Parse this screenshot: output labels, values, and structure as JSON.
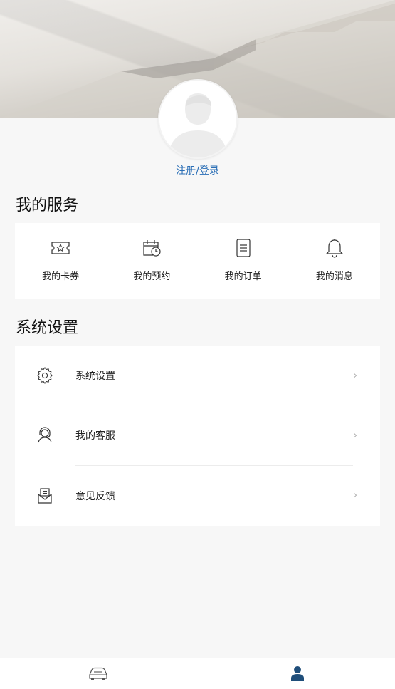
{
  "profile": {
    "login_label": "注册/登录"
  },
  "services": {
    "title": "我的服务",
    "items": [
      {
        "label": "我的卡券",
        "icon": "coupon-icon"
      },
      {
        "label": "我的预约",
        "icon": "calendar-clock-icon"
      },
      {
        "label": "我的订单",
        "icon": "order-list-icon"
      },
      {
        "label": "我的消息",
        "icon": "bell-icon"
      }
    ]
  },
  "settings": {
    "title": "系统设置",
    "items": [
      {
        "label": "系统设置",
        "icon": "gear-icon",
        "chevron": "›"
      },
      {
        "label": "我的客服",
        "icon": "customer-service-icon",
        "chevron": "›"
      },
      {
        "label": "意见反馈",
        "icon": "feedback-icon",
        "chevron": "›"
      }
    ]
  },
  "tabbar": {
    "tabs": [
      {
        "icon": "car-icon",
        "active": false
      },
      {
        "icon": "user-icon",
        "active": true
      }
    ]
  },
  "colors": {
    "link": "#2b6fb6",
    "active_tab": "#1f4e7a",
    "background": "#f7f7f7"
  }
}
